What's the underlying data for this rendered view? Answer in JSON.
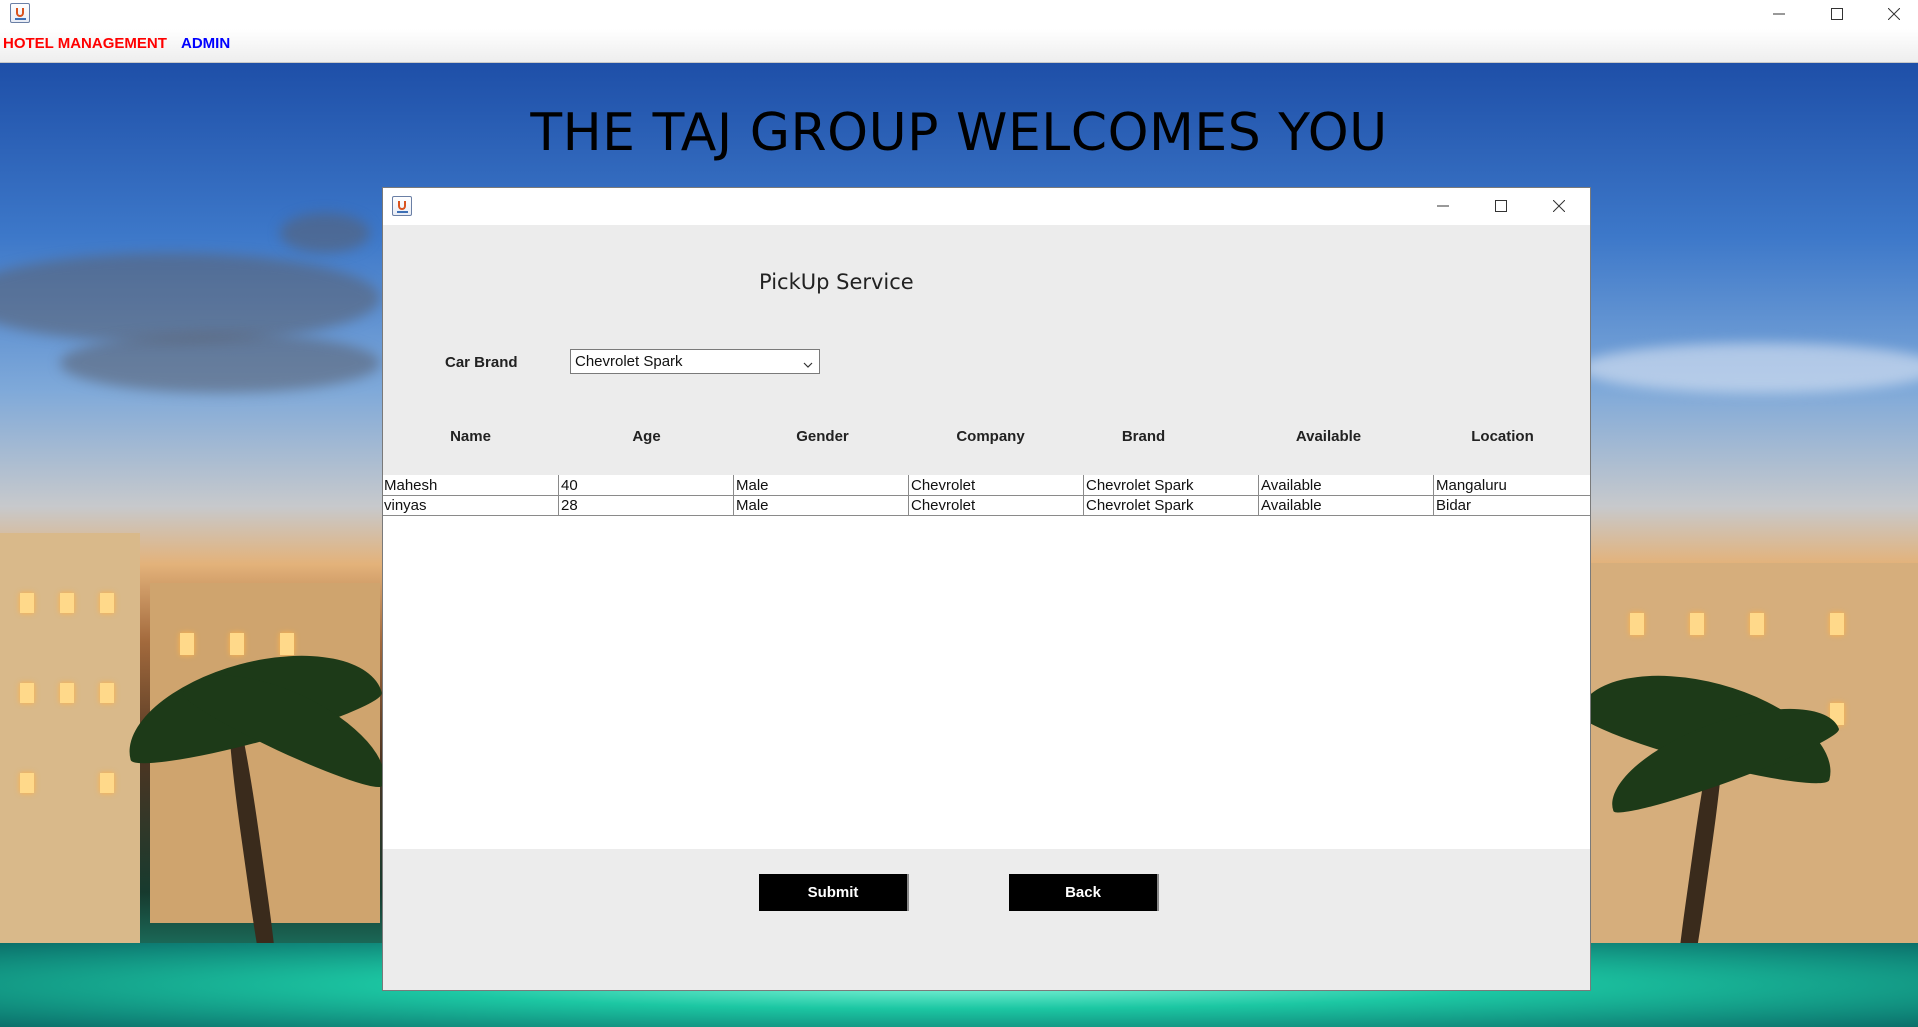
{
  "menubar": {
    "items": [
      {
        "label": "HOTEL MANAGEMENT",
        "color": "#ff0000"
      },
      {
        "label": "ADMIN",
        "color": "#0000ff"
      }
    ]
  },
  "headline": "THE TAJ GROUP WELCOMES YOU",
  "dialog": {
    "title": "PickUp Service",
    "car_brand_label": "Car Brand",
    "car_brand_value": "Chevrolet Spark",
    "columns": [
      "Name",
      "Age",
      "Gender",
      "Company",
      "Brand",
      "Available",
      "Location"
    ],
    "rows": [
      [
        "Mahesh",
        "40",
        "Male",
        "Chevrolet",
        "Chevrolet Spark",
        "Available",
        "Mangaluru"
      ],
      [
        "vinyas",
        "28",
        "Male",
        "Chevrolet",
        "Chevrolet Spark",
        "Available",
        "Bidar"
      ]
    ],
    "submit_label": "Submit",
    "back_label": "Back"
  }
}
